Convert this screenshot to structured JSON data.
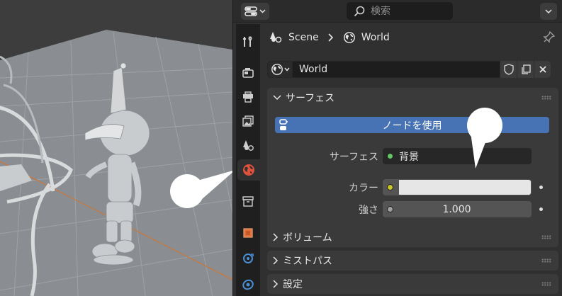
{
  "header": {
    "editor_type_icon": "properties-editor-icon",
    "search_placeholder": "検索"
  },
  "tabs": [
    {
      "name": "tool",
      "icon": "wrench-screwdriver-icon"
    },
    {
      "name": "render",
      "icon": "camera-back-icon"
    },
    {
      "name": "output",
      "icon": "printer-icon"
    },
    {
      "name": "view-layer",
      "icon": "image-stack-icon"
    },
    {
      "name": "scene",
      "icon": "scene-cone-sphere-icon"
    },
    {
      "name": "world",
      "icon": "world-globe-icon",
      "active": true
    },
    {
      "name": "collection",
      "icon": "collection-box-icon"
    },
    {
      "name": "object",
      "icon": "object-square-icon"
    },
    {
      "name": "modifiers",
      "icon": "modifier-icon"
    },
    {
      "name": "particles",
      "icon": "particles-icon"
    }
  ],
  "breadcrumb": {
    "scene": "Scene",
    "world": "World"
  },
  "datablock": {
    "name": "World"
  },
  "panels": {
    "surface": {
      "title": "サーフェス",
      "use_nodes_label": "ノードを使用",
      "surface_label": "サーフェス",
      "surface_value": "背景",
      "color_label": "カラー",
      "color_value": "#e6e6e6",
      "strength_label": "強さ",
      "strength_value": "1.000"
    },
    "volume": {
      "title": "ボリューム"
    },
    "mist": {
      "title": "ミストパス"
    },
    "settings": {
      "title": "設定"
    }
  },
  "colors": {
    "accent_blue": "#4772b3",
    "socket_green": "#63c763",
    "socket_yellow": "#c7c729",
    "socket_gray": "#a1a1a1",
    "active_tab_red": "#e0513d"
  }
}
